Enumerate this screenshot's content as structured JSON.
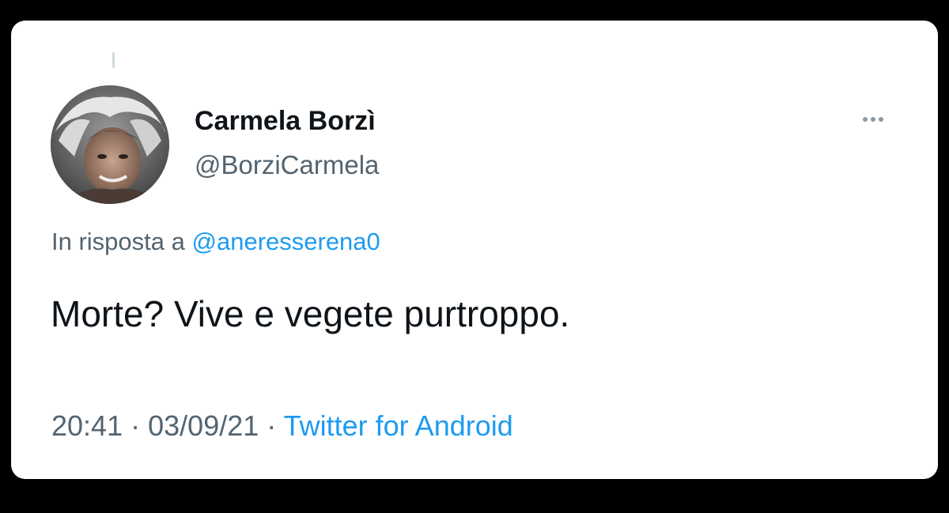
{
  "tweet": {
    "author_name": "Carmela Borzì",
    "author_handle": "@BorziCarmela",
    "reply_prefix": "In risposta a",
    "reply_to": "@aneresserena0",
    "text": "Morte? Vive e vegete purtroppo.",
    "time": "20:41",
    "separator": "·",
    "date": "03/09/21",
    "source": "Twitter for Android",
    "more_icon": "more-horizontal-icon"
  },
  "colors": {
    "background": "#000000",
    "card": "#ffffff",
    "primary_text": "#0f1419",
    "secondary_text": "#536471",
    "link": "#1d9bf0"
  }
}
